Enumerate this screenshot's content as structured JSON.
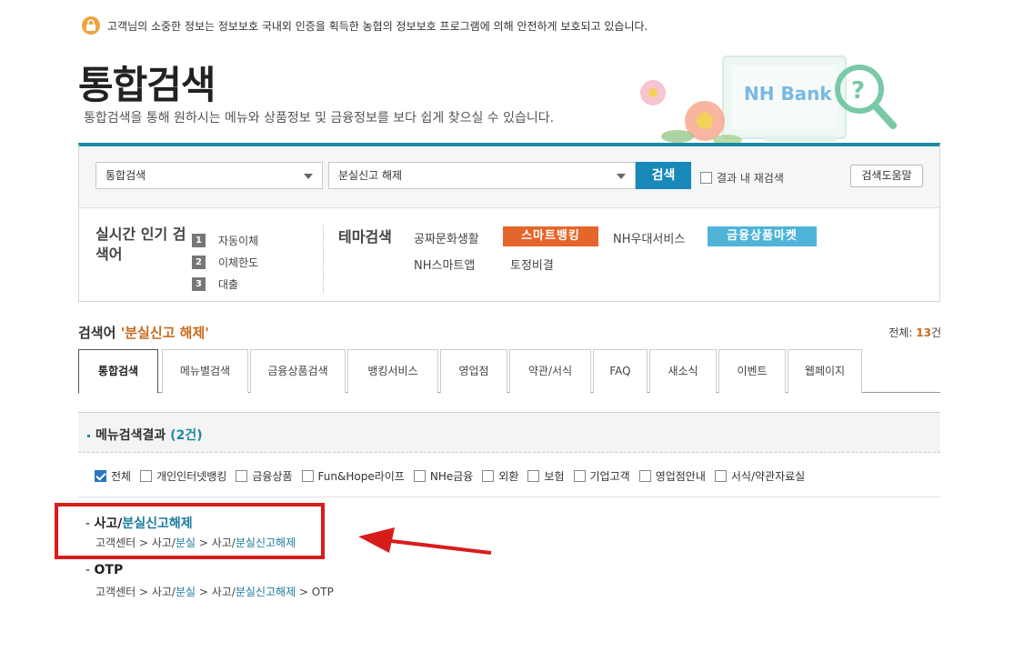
{
  "notice": {
    "text": "고객님의 소중한 정보는 정보보호 국내외 인증을 획득한 농협의 정보보호 프로그램에 의해 안전하게 보호되고 있습니다."
  },
  "page": {
    "title": "통합검색",
    "subtitle": "통합검색을 통해 원하시는 메뉴와 상품정보 및 금융정보를 보다 쉽게 찾으실 수 있습니다."
  },
  "hero": {
    "brand": "NH Bank"
  },
  "search": {
    "category": "통합검색",
    "query": "분실신고 해제",
    "button": "검색",
    "rescan_label": "결과 내 재검색",
    "help_button": "검색도움말"
  },
  "popular": {
    "title": "실시간 인기 검색어",
    "items": [
      {
        "rank": "1",
        "label": "자동이체"
      },
      {
        "rank": "2",
        "label": "이체한도"
      },
      {
        "rank": "3",
        "label": "대출"
      }
    ]
  },
  "theme": {
    "title": "테마검색",
    "items": [
      "공짜문화생활",
      "스마트뱅킹",
      "NH우대서비스",
      "금융상품마켓",
      "NH스마트앱",
      "토정비결"
    ],
    "colors": {
      "smart": "#e5662b",
      "market": "#4fb4d8"
    }
  },
  "results": {
    "head_prefix": "검색어",
    "keyword": "'분실신고 해제'",
    "total_prefix": "전체: ",
    "total_count": "13",
    "total_suffix": "건"
  },
  "tabs": [
    "통합검색",
    "메뉴별검색",
    "금융상품검색",
    "뱅킹서비스",
    "영업점",
    "약관/서식",
    "FAQ",
    "새소식",
    "이벤트",
    "웹페이지"
  ],
  "menu_section": {
    "title": "메뉴검색결과",
    "count_open": "(",
    "count": "2건",
    "count_close": ")"
  },
  "filters": [
    {
      "label": "전체",
      "checked": true
    },
    {
      "label": "개인인터넷뱅킹",
      "checked": false
    },
    {
      "label": "금융상품",
      "checked": false
    },
    {
      "label": "Fun&Hope라이프",
      "checked": false
    },
    {
      "label": "NHe금융",
      "checked": false
    },
    {
      "label": "외환",
      "checked": false
    },
    {
      "label": "보험",
      "checked": false
    },
    {
      "label": "기업고객",
      "checked": false
    },
    {
      "label": "영업점안내",
      "checked": false
    },
    {
      "label": "서식/약관자료실",
      "checked": false
    }
  ],
  "result_items": [
    {
      "dash": "- ",
      "title_a": "사고/",
      "title_b": "분실신고해제",
      "path_a": "고객센터 > 사고/",
      "path_b": "분실",
      "path_c": " > 사고/",
      "path_d": "분실신고해제",
      "path_e": ""
    },
    {
      "dash": "- ",
      "title_a": "OTP",
      "title_b": "",
      "path_a": "고객센터 > 사고/",
      "path_b": "분실",
      "path_c": " > 사고/",
      "path_d": "분실신고해제",
      "path_e": " > OTP"
    }
  ]
}
